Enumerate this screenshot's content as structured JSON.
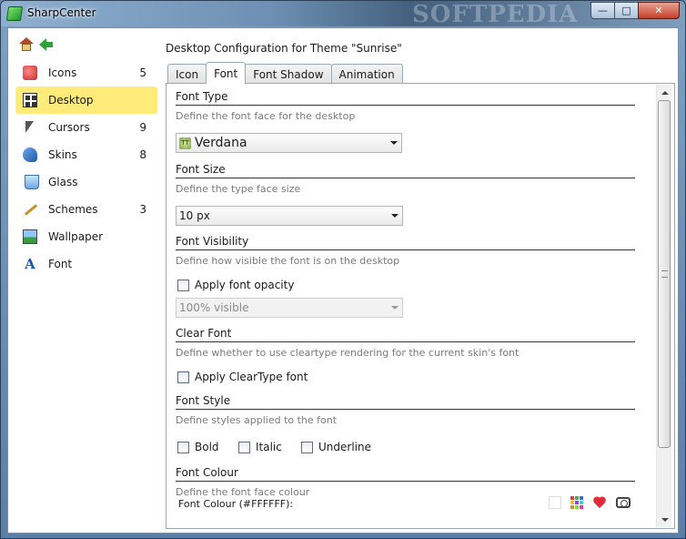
{
  "window": {
    "title": "SharpCenter",
    "watermark": "SOFTPEDIA",
    "controls": {
      "minimize": "—",
      "maximize": "□",
      "close": "✕"
    }
  },
  "sidebar": {
    "items": [
      {
        "label": "Icons",
        "count": "5",
        "icon": "icons-icon"
      },
      {
        "label": "Desktop",
        "count": "",
        "icon": "desktop-icon",
        "active": true
      },
      {
        "label": "Cursors",
        "count": "9",
        "icon": "cursor-icon"
      },
      {
        "label": "Skins",
        "count": "8",
        "icon": "skins-icon"
      },
      {
        "label": "Glass",
        "count": "",
        "icon": "glass-icon"
      },
      {
        "label": "Schemes",
        "count": "3",
        "icon": "schemes-icon"
      },
      {
        "label": "Wallpaper",
        "count": "",
        "icon": "wallpaper-icon"
      },
      {
        "label": "Font",
        "count": "",
        "icon": "font-icon"
      }
    ]
  },
  "main": {
    "title": "Desktop Configuration for Theme \"Sunrise\"",
    "tabs": [
      {
        "label": "Icon"
      },
      {
        "label": "Font",
        "active": true
      },
      {
        "label": "Font Shadow"
      },
      {
        "label": "Animation"
      }
    ],
    "font_type": {
      "title": "Font Type",
      "desc": "Define the font face for the desktop",
      "glyph": "TT",
      "value": "Verdana"
    },
    "font_size": {
      "title": "Font Size",
      "desc": "Define the type face size",
      "value": "10 px"
    },
    "font_visibility": {
      "title": "Font Visibility",
      "desc": "Define how visible the font is on the desktop",
      "checkbox": "Apply font opacity",
      "value": "100% visible"
    },
    "clear_font": {
      "title": "Clear Font",
      "desc": "Define whether to use cleartype rendering for the current skin's font",
      "checkbox": "Apply ClearType font"
    },
    "font_style": {
      "title": "Font Style",
      "desc": "Define styles applied to the font",
      "bold": "Bold",
      "italic": "Italic",
      "underline": "Underline"
    },
    "font_colour": {
      "title": "Font Colour",
      "desc": "Define the font face colour",
      "label": "Font Colour (#FFFFFF):",
      "swatch": "#FFFFFF"
    }
  }
}
